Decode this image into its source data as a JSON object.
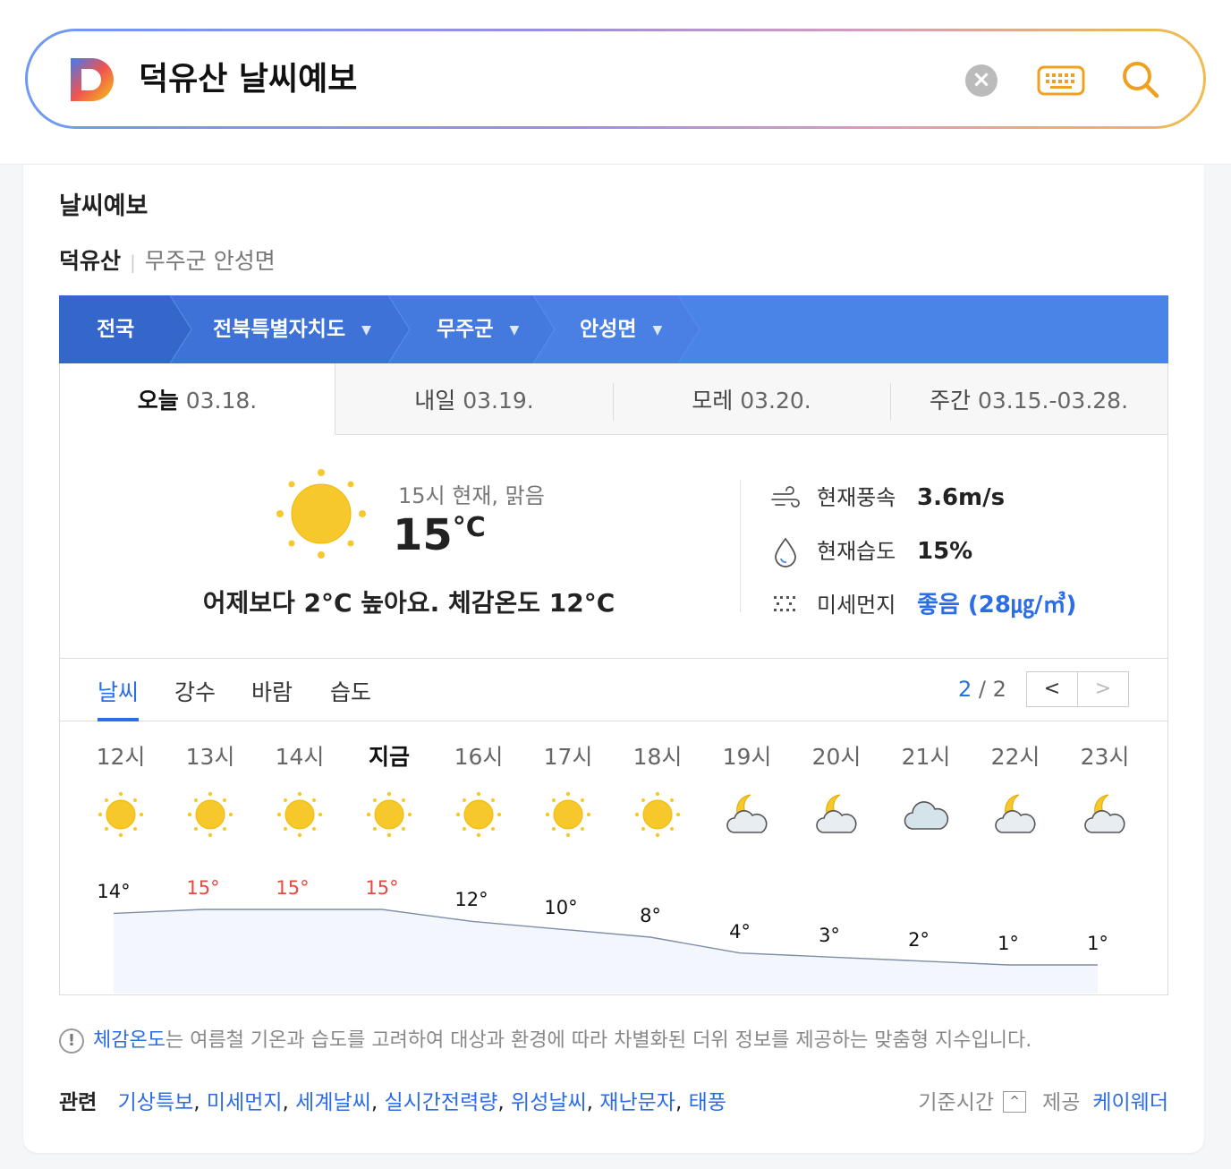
{
  "search": {
    "query": "덕유산 날씨예보",
    "logo_letter": "D"
  },
  "icons": {
    "clear": "clear-icon",
    "keyboard": "keyboard-icon",
    "search": "search-icon"
  },
  "card": {
    "title": "날씨예보",
    "location_main": "덕유산",
    "location_sub": "무주군 안성면"
  },
  "regions": [
    {
      "label": "전국",
      "has_dropdown": false
    },
    {
      "label": "전북특별자치도",
      "has_dropdown": true
    },
    {
      "label": "무주군",
      "has_dropdown": true
    },
    {
      "label": "안성면",
      "has_dropdown": true
    }
  ],
  "day_tabs": [
    {
      "label": "오늘",
      "date": "03.18.",
      "active": true
    },
    {
      "label": "내일",
      "date": "03.19.",
      "active": false
    },
    {
      "label": "모레",
      "date": "03.20.",
      "active": false
    },
    {
      "label": "주간",
      "date": "03.15.-03.28.",
      "active": false
    }
  ],
  "now": {
    "desc": "15시 현재, 맑음",
    "temp": "15",
    "unit": "°C",
    "compare": "어제보다 2°C 높아요.  체감온도 12°C",
    "wind_label": "현재풍속",
    "wind_value": "3.6m/s",
    "humidity_label": "현재습도",
    "humidity_value": "15%",
    "dust_label": "미세먼지",
    "dust_value": "좋음 (28㎍/㎥)"
  },
  "sub_tabs": [
    "날씨",
    "강수",
    "바람",
    "습도"
  ],
  "pager": {
    "current": "2",
    "sep": "/",
    "total": "2",
    "prev": "<",
    "next": ">"
  },
  "hourly": [
    {
      "hour": "12시",
      "icon": "sun-icon",
      "temp": 14,
      "label": "14°"
    },
    {
      "hour": "13시",
      "icon": "sun-icon",
      "temp": 15,
      "label": "15°"
    },
    {
      "hour": "14시",
      "icon": "sun-icon",
      "temp": 15,
      "label": "15°"
    },
    {
      "hour": "지금",
      "icon": "sun-icon",
      "temp": 15,
      "label": "15°"
    },
    {
      "hour": "16시",
      "icon": "sun-icon",
      "temp": 12,
      "label": "12°"
    },
    {
      "hour": "17시",
      "icon": "sun-icon",
      "temp": 10,
      "label": "10°"
    },
    {
      "hour": "18시",
      "icon": "sun-icon",
      "temp": 8,
      "label": "8°"
    },
    {
      "hour": "19시",
      "icon": "moon-cloud-icon",
      "temp": 4,
      "label": "4°"
    },
    {
      "hour": "20시",
      "icon": "moon-cloud-icon",
      "temp": 3,
      "label": "3°"
    },
    {
      "hour": "21시",
      "icon": "cloud-icon",
      "temp": 2,
      "label": "2°"
    },
    {
      "hour": "22시",
      "icon": "moon-cloud-icon",
      "temp": 1,
      "label": "1°"
    },
    {
      "hour": "23시",
      "icon": "moon-cloud-icon",
      "temp": 1,
      "label": "1°"
    }
  ],
  "note": {
    "link": "체감온도",
    "text": "는 여름철 기온과 습도를 고려하여 대상과 환경에 따라 차별화된 더위 정보를 제공하는 맞춤형 지수입니다."
  },
  "related": {
    "title": "관련",
    "links": [
      "기상특보",
      "미세먼지",
      "세계날씨",
      "실시간전력량",
      "위성날씨",
      "재난문자",
      "태풍"
    ]
  },
  "basis": {
    "label": "기준시간",
    "provider_label": "제공",
    "provider": "케이웨더"
  },
  "colors": {
    "accent": "#2b6de5",
    "region_bar": "#4a84e6",
    "region_dark": "#3566c9",
    "hot": "#e34b3c",
    "sun": "#f5c518"
  }
}
